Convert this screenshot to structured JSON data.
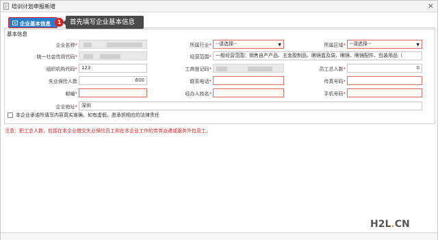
{
  "window": {
    "title": "培训计划申报新增"
  },
  "tabs": [
    {
      "label": "企业基本信息",
      "active": true
    }
  ],
  "annotation": {
    "number": "1",
    "text": "首先填写企业基本信息"
  },
  "panel": {
    "title": "基本信息"
  },
  "fields": {
    "company_name": {
      "label": "企业名称",
      "required": true,
      "value": ""
    },
    "industry": {
      "label": "所属行业",
      "required": true,
      "value": "--请选择--"
    },
    "region": {
      "label": "所属区域",
      "required": true,
      "value": "--请选择--"
    },
    "credit_code": {
      "label": "统一社会信用代码",
      "required": true,
      "value": ""
    },
    "business_scope": {
      "label": "经营范围",
      "required": true,
      "value": "一般经营范围：销售自产产品、五金胶制品、眼镜盒及袋、眼镜、眼镜配件、包装用品（"
    },
    "org_code": {
      "label": "组织机构代码",
      "required": true,
      "value": "123"
    },
    "business_reg_no": {
      "label": "工商登记码",
      "required": true,
      "value": ""
    },
    "employee_count": {
      "label": "员工总人数",
      "required": true,
      "value": "0"
    },
    "insured_count": {
      "label": "失业保险人数",
      "required": false,
      "value": "600"
    },
    "contact_phone": {
      "label": "联系电话",
      "required": true,
      "value": ""
    },
    "fax": {
      "label": "传真号码",
      "required": true,
      "value": ""
    },
    "postcode": {
      "label": "邮编",
      "required": true,
      "value": ""
    },
    "handler_name": {
      "label": "经办人姓名",
      "required": true,
      "value": ""
    },
    "mobile": {
      "label": "手机号码",
      "required": true,
      "value": ""
    },
    "address": {
      "label": "企业地址",
      "required": true,
      "value": "深圳"
    }
  },
  "declaration": "本企业承诺所填写内容真实准确、如有虚假，愿承担相应的法律责任",
  "notice": "注意：职工总人数，包括在本企业缴交失业保险员工和在本企业工作的劳务派遣或服务外包员工。",
  "watermark": {
    "left": "H2L",
    "dot": ".",
    "right": "CN"
  },
  "colors": {
    "tab_active": "#2a7dcc",
    "highlight": "#e02020",
    "required": "#e02020",
    "notice": "#d82020",
    "tooltip_bg": "#4a4a4a"
  }
}
